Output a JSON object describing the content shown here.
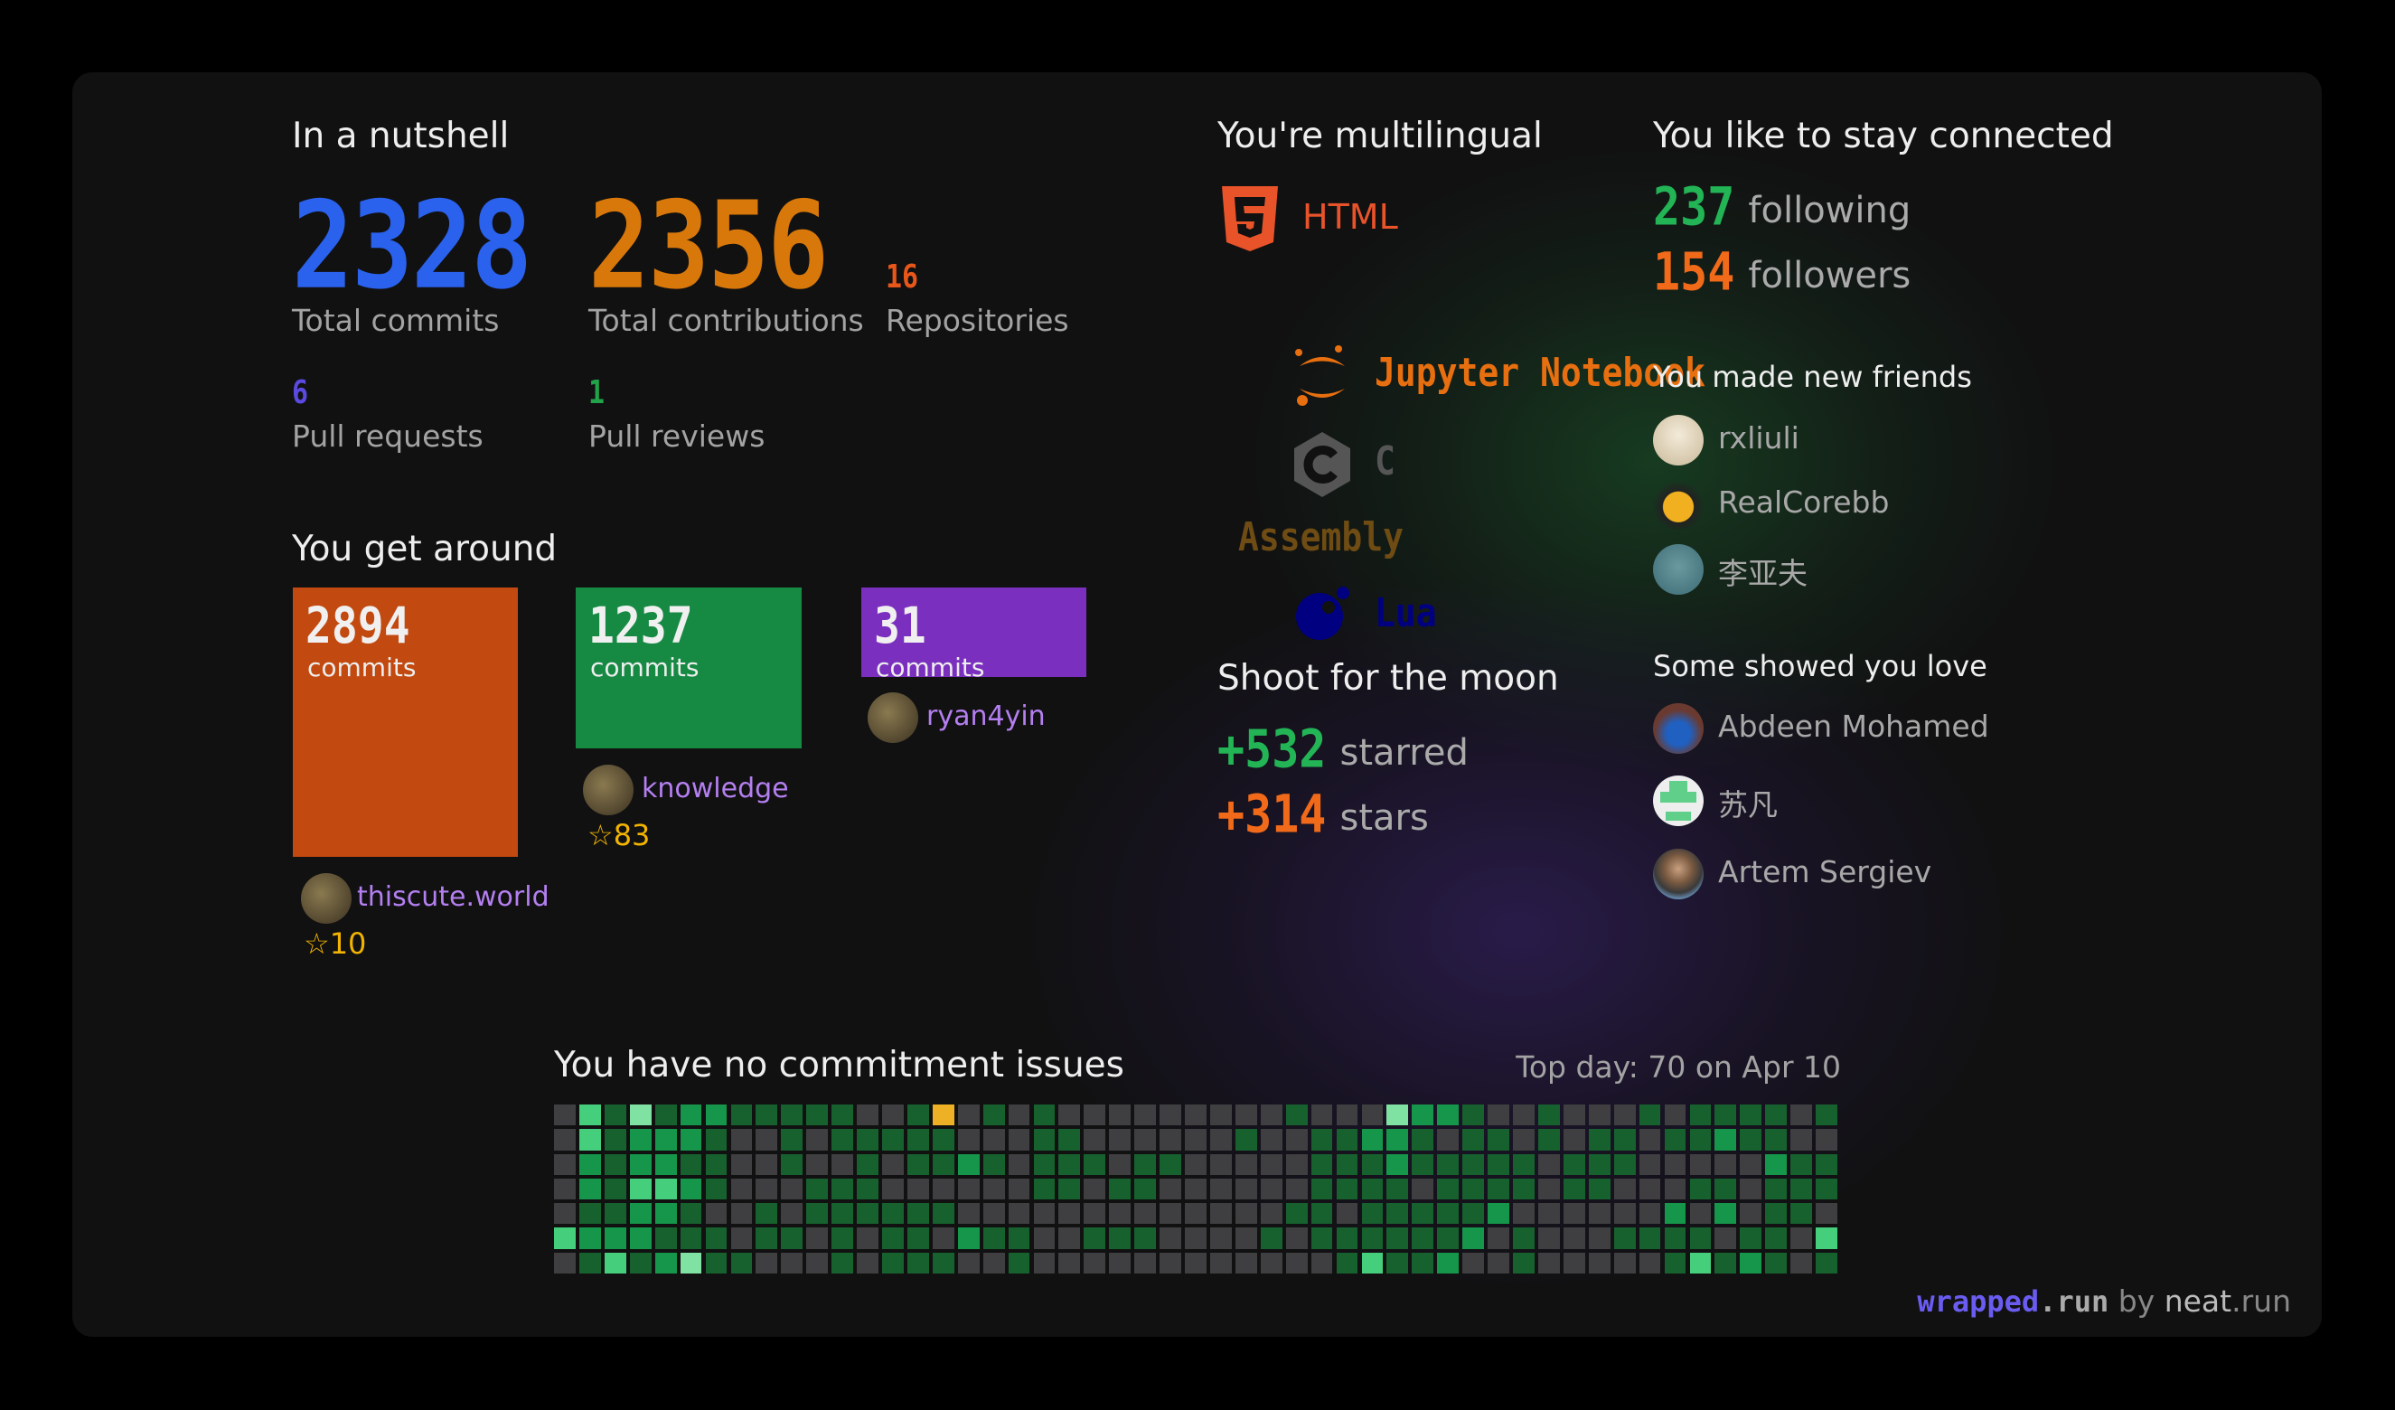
{
  "nutshell": {
    "title": "In a nutshell",
    "total_commits": "2328",
    "total_commits_label": "Total commits",
    "total_contributions": "2356",
    "total_contributions_label": "Total contributions",
    "repositories": "16",
    "repositories_label": "Repositories",
    "pull_requests": "6",
    "pull_requests_label": "Pull requests",
    "pull_reviews": "1",
    "pull_reviews_label": "Pull reviews"
  },
  "get_around": {
    "title": "You get around",
    "repos": [
      {
        "commits": "2894",
        "unit": "commits",
        "name": "thiscute.world",
        "stars": "10",
        "color": "#c2490f"
      },
      {
        "commits": "1237",
        "unit": "commits",
        "name": "knowledge",
        "stars": "83",
        "color": "#168a43"
      },
      {
        "commits": "31",
        "unit": "commits",
        "name": "ryan4yin",
        "color": "#7b2fbf"
      }
    ]
  },
  "languages": {
    "title": "You're multilingual",
    "items": [
      {
        "name": "HTML",
        "icon": "html5-icon",
        "color": "#e8532a"
      },
      {
        "name": "Jupyter Notebook",
        "icon": "jupyter-icon",
        "color": "#e86f10"
      },
      {
        "name": "C",
        "icon": "c-icon",
        "color": "#555555"
      },
      {
        "name": "Assembly",
        "color": "#6e4c13"
      },
      {
        "name": "Lua",
        "icon": "lua-icon",
        "color": "#000080"
      }
    ]
  },
  "moon": {
    "title": "Shoot for the moon",
    "starred": "+532",
    "starred_label": "starred",
    "stars": "+314",
    "stars_label": "stars"
  },
  "connected": {
    "title": "You like to stay connected",
    "following": "237",
    "following_label": "following",
    "followers": "154",
    "followers_label": "followers",
    "friends_title": "You made new friends",
    "friends": [
      "rxliuli",
      "RealCorebb",
      "李亚夫"
    ],
    "love_title": "Some showed you love",
    "lovers": [
      "Abdeen Mohamed",
      "苏凡",
      "Artem Sergiev"
    ]
  },
  "commitment": {
    "title": "You have no commitment issues",
    "top_day": "Top day: 70 on Apr 10",
    "level_colors": [
      "#3f3f41",
      "#17612f",
      "#16964a",
      "#45cf7c",
      "#80e2a2",
      "#eeb126"
    ],
    "rows": [
      "031412211111001501010000000001000422100100010111101",
      "031222100101111100011000000100112210110101101121100",
      "021221100100101121011101100000111211111011100000211",
      "021332100011100000011011000000111101111011000110111",
      "011221001011111100000000000001101111120000002020110",
      "322211101101011021100111000010111111201000111101103",
      "013124110001011100100000000000013112001000001312101"
    ]
  },
  "footer": {
    "brand": "wrapped",
    "brand_tld": ".run",
    "by": "by",
    "author": "neat",
    "author_tld": ".run"
  }
}
